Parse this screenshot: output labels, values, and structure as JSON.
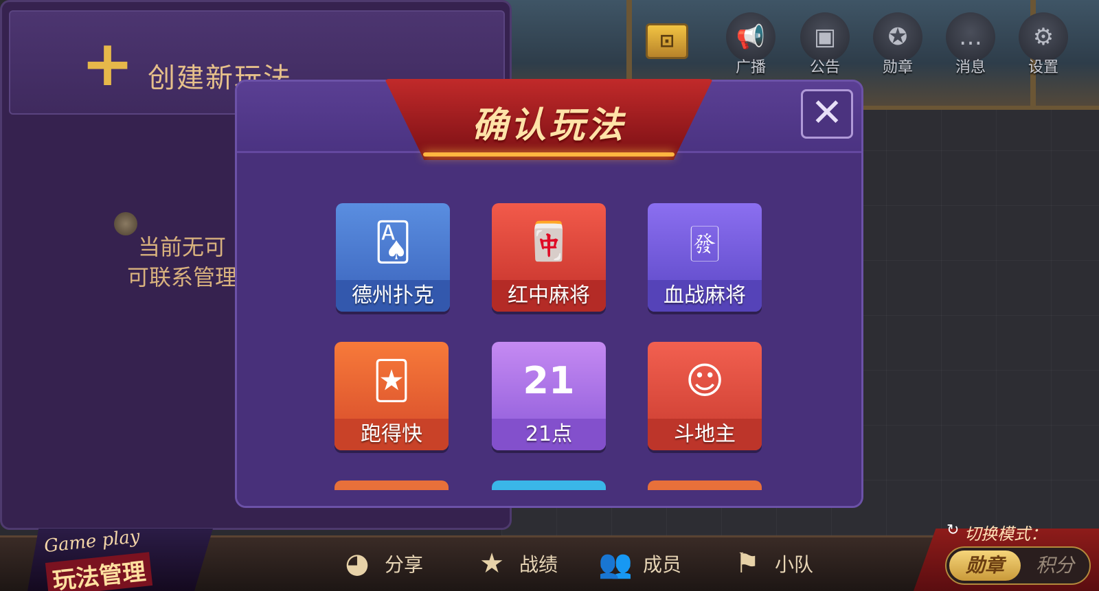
{
  "top_icons": [
    {
      "label": "广播",
      "icon": "megaphone-icon",
      "glyph": "📢"
    },
    {
      "label": "公告",
      "icon": "notice-board-icon",
      "glyph": "▣"
    },
    {
      "label": "勋章",
      "icon": "medal-icon",
      "glyph": "✪"
    },
    {
      "label": "消息",
      "icon": "message-icon",
      "glyph": "…"
    },
    {
      "label": "设置",
      "icon": "gear-icon",
      "glyph": "⚙"
    }
  ],
  "left_panel": {
    "create_label": "创建新玩法",
    "empty_line1": "当前无可",
    "empty_line2": "可联系管理"
  },
  "modal": {
    "title": "确认玩法",
    "close_glyph": "✕",
    "games": [
      {
        "name": "德州扑克",
        "art": "🂡"
      },
      {
        "name": "红中麻将",
        "art": "🀄"
      },
      {
        "name": "血战麻将",
        "art": "🀅"
      },
      {
        "name": "跑得快",
        "art": "🃏"
      },
      {
        "name": "21点",
        "art": "21"
      },
      {
        "name": "斗地主",
        "art": "☺"
      }
    ]
  },
  "bottom_bar": {
    "logo_script": "Game play",
    "logo_cn": "玩法管理",
    "nav": [
      {
        "label": "分享",
        "icon": "wechat-icon",
        "glyph": "◕"
      },
      {
        "label": "战绩",
        "icon": "trophy-medal-icon",
        "glyph": "★"
      },
      {
        "label": "成员",
        "icon": "members-icon",
        "glyph": "👥"
      },
      {
        "label": "小队",
        "icon": "flag-icon",
        "glyph": "⚑"
      }
    ],
    "mode_label": "切换模式：",
    "mode_active": "勋章",
    "mode_inactive": "积分"
  }
}
